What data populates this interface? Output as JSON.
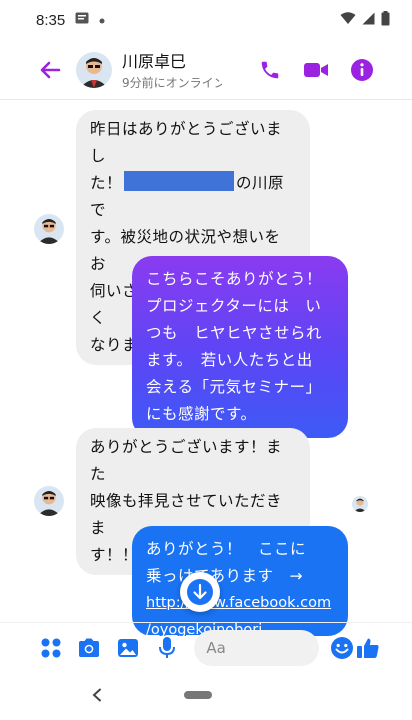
{
  "status_bar": {
    "time": "8:35"
  },
  "header": {
    "contact_name": "川原卓巳",
    "contact_status": "9分前にオンライン"
  },
  "messages": [
    {
      "line1": "昨日はありがとうございまし",
      "line2_pre": "た！",
      "line2_post": "の川原で",
      "line3": "す。被災地の状況や想いをお",
      "line4": "伺いさせていただき胸が熱く",
      "line5": "なりました！"
    },
    {
      "lines": [
        "こちらこそありがとう！",
        "プロジェクターには　い",
        "つも　ヒヤヒヤさせられ",
        "ます。　若い人たちと出",
        "会える「元気セミナー」",
        "にも感謝です。"
      ]
    },
    {
      "lines": [
        "ありがとうございます！また",
        "映像も拝見させていただきま",
        "す！！"
      ]
    },
    {
      "line1": "ありがとう！　ここに",
      "line2": "乗っけてあります　→",
      "link1": "http://www.facebook.com",
      "link2": "/oyogekoinobori"
    }
  ],
  "composer": {
    "placeholder": "Aa"
  },
  "colors": {
    "accent_purple": "#9b22e0",
    "bubble_blue": "#1a73f2",
    "bubble_gradient_top": "#8a3bf0",
    "incoming_bg": "#eeeeee",
    "icon_blue": "#1a73f2"
  },
  "icons": {
    "back": "arrow-left-icon",
    "call": "phone-icon",
    "video": "video-camera-icon",
    "info": "info-icon",
    "apps": "four-dots-icon",
    "camera": "camera-icon",
    "gallery": "image-icon",
    "mic": "microphone-icon",
    "emoji": "smiley-icon",
    "like": "thumbs-up-icon",
    "scroll_down": "arrow-down-icon"
  }
}
